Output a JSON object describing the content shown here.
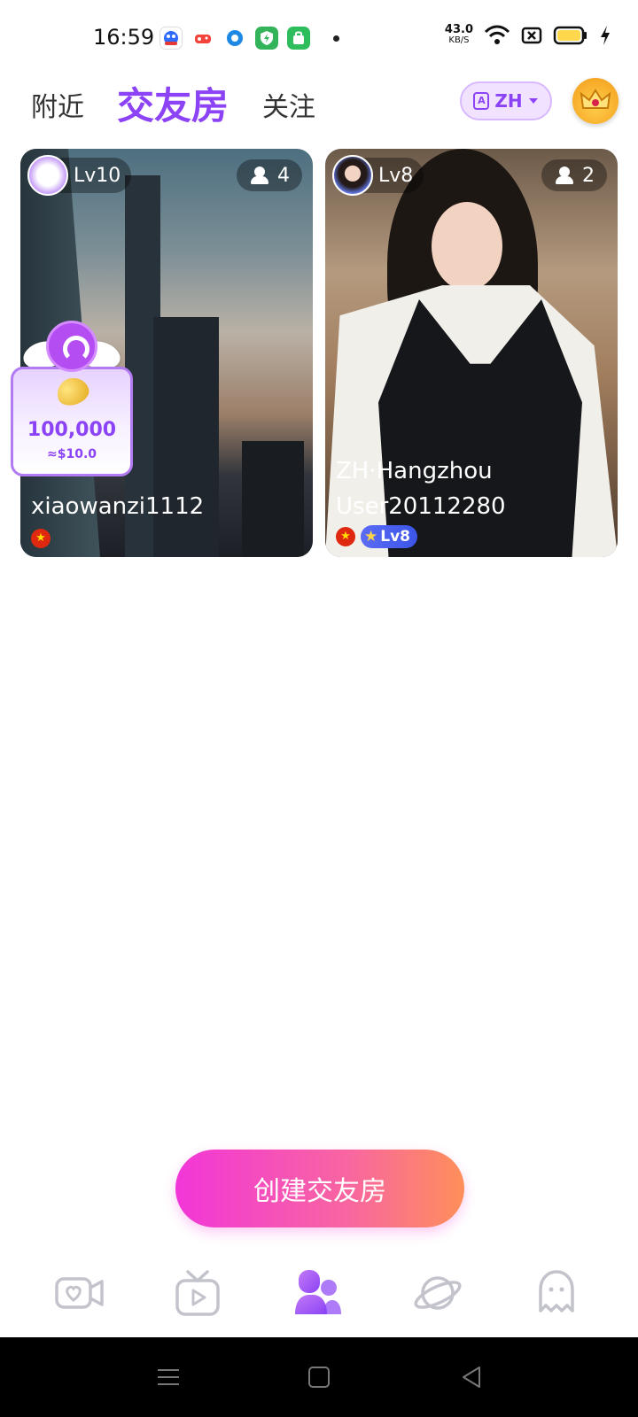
{
  "status_bar": {
    "time": "16:59",
    "net_speed_value": "43.0",
    "net_speed_unit": "KB/S",
    "icons": [
      "baidu-app-icon",
      "game-app-icon",
      "browser-app-icon",
      "security-app-icon",
      "store-app-icon",
      "wifi-icon",
      "sim-x-icon",
      "battery-icon",
      "charging-icon"
    ]
  },
  "header": {
    "tabs": [
      {
        "label": "附近"
      },
      {
        "label": "交友房",
        "active": true
      },
      {
        "label": "关注"
      }
    ],
    "language": "ZH",
    "accent_color": "#8b43f5"
  },
  "rooms": [
    {
      "level": "Lv10",
      "participants": "4",
      "title": "",
      "username": "xiaowanzi1112"
    },
    {
      "level": "Lv8",
      "participants": "2",
      "title": "ZH·Hangzhou",
      "username": "User20112280",
      "badge": "Lv8"
    }
  ],
  "reward_popup": {
    "amount": "100,000",
    "usd": "≈$10.0"
  },
  "create_button": {
    "label": "创建交友房"
  },
  "bottom_nav": {
    "items": [
      "video-chat-icon",
      "tv-icon",
      "rooms-icon",
      "planet-icon",
      "ghost-icon"
    ],
    "active_index": 2
  }
}
